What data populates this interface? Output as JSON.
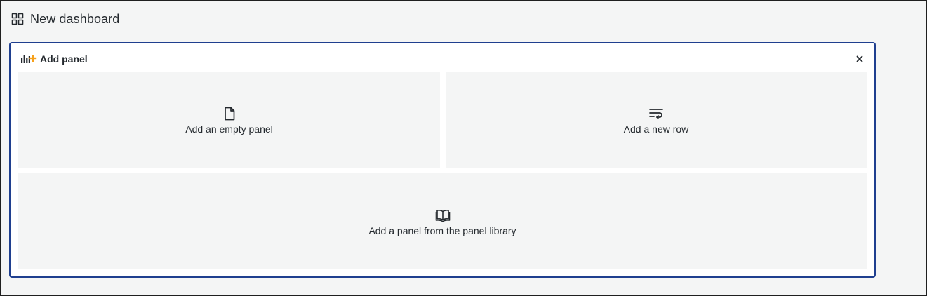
{
  "dashboard": {
    "title": "New dashboard",
    "icon": "dashboard-grid-icon"
  },
  "add_panel": {
    "title": "Add panel",
    "icon": "add-panel-icon",
    "close_icon": "close-icon",
    "accent_color": "#f6a01a",
    "border_color": "#1f3f8f",
    "options": {
      "empty": {
        "label": "Add an empty panel",
        "icon": "file-icon"
      },
      "row": {
        "label": "Add a new row",
        "icon": "wrap-text-icon"
      },
      "library": {
        "label": "Add a panel from the panel library",
        "icon": "book-open-icon"
      }
    }
  }
}
